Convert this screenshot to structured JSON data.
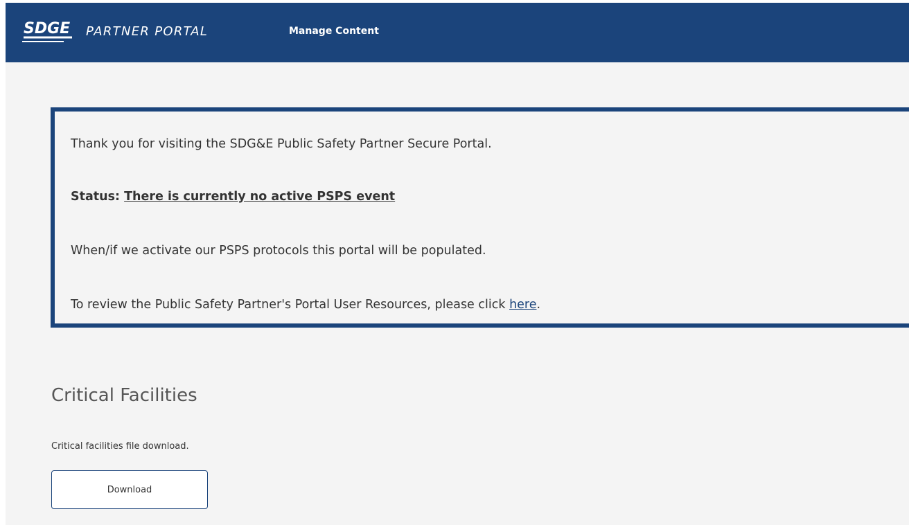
{
  "header": {
    "logo_text": "SDGE",
    "brand_title": "PARTNER PORTAL",
    "nav_link": "Manage Content"
  },
  "notice": {
    "welcome": "Thank you for visiting the SDG&E Public Safety Partner Secure Portal.",
    "status_label": "Status: ",
    "status_value": "There is currently no active PSPS event",
    "activation_text": "When/if we activate our PSPS protocols this portal will be populated.",
    "review_prefix": "To review the Public Safety Partner's Portal User Resources, please click ",
    "review_link": "here",
    "review_suffix": "."
  },
  "critical_facilities": {
    "title": "Critical Facilities",
    "description": "Critical facilities file download.",
    "download_label": "Download"
  },
  "colors": {
    "brand_blue": "#1b447b",
    "background": "#f4f4f4"
  }
}
